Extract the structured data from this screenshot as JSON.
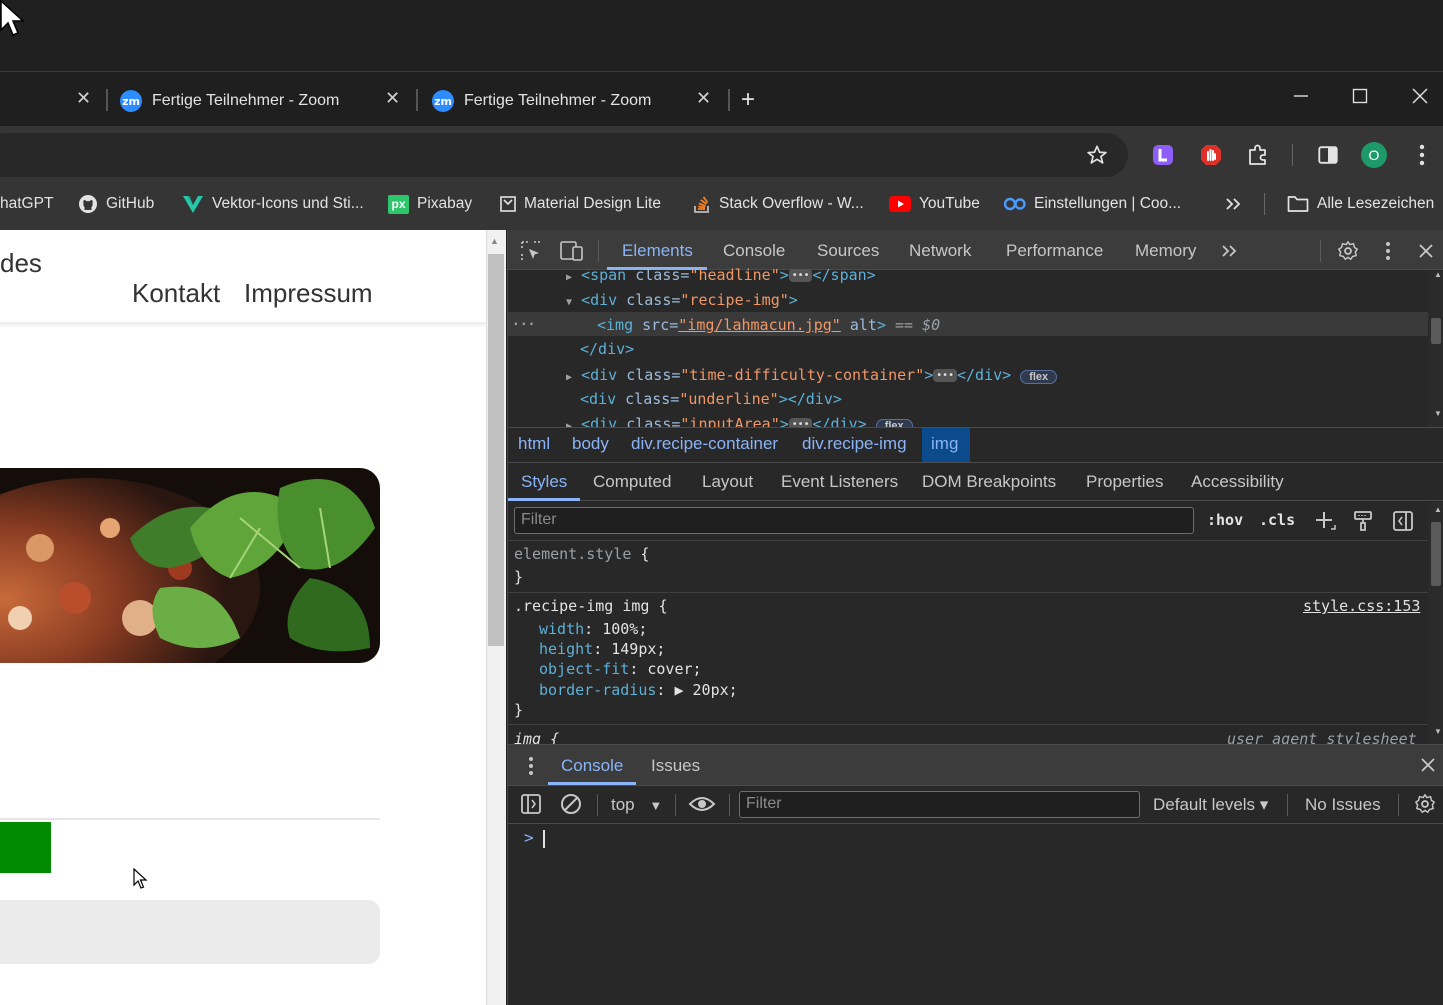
{
  "tabs": [
    {
      "label": "Fertige Teilnehmer - Zoom",
      "icon_text": "zm"
    },
    {
      "label": "Fertige Teilnehmer - Zoom",
      "icon_text": "zm"
    }
  ],
  "new_tab": "+",
  "profile_initial": "O",
  "bookmarks": {
    "items": [
      "hatGPT",
      "GitHub",
      "Vektor-Icons und Sti...",
      "Pixabay",
      "Material Design Lite",
      "Stack Overflow - W...",
      "YouTube",
      "Einstellungen | Coo..."
    ],
    "pixabay_icon_text": "px",
    "all_bookmarks": "Alle Lesezeichen"
  },
  "page": {
    "title_fragment": "des",
    "nav": [
      "Kontakt",
      "Impressum"
    ]
  },
  "devtools": {
    "tabs": [
      "Elements",
      "Console",
      "Sources",
      "Network",
      "Performance",
      "Memory"
    ],
    "active_tab": "Elements",
    "dom": {
      "line1": {
        "tag_open": "<span ",
        "attr": "class=",
        "val": "\"headline\"",
        "close": ">",
        "end": "</span>"
      },
      "line2": {
        "tag_open": "<div ",
        "attr": "class=",
        "val": "\"recipe-img\"",
        "close": ">"
      },
      "line3": {
        "tag_open": "<img ",
        "attr": "src=",
        "val": "\"img/lahmacun.jpg\"",
        "attr2": " alt",
        "close": ">",
        "suffix": " == $0"
      },
      "line4": "</div>",
      "line5": {
        "tag_open": "<div ",
        "attr": "class=",
        "val": "\"time-difficulty-container\"",
        "close": ">",
        "end": "</div>",
        "badge": "flex"
      },
      "line6": {
        "tag_open": "<div ",
        "attr": "class=",
        "val": "\"underline\"",
        "close": "></div>"
      },
      "line7": {
        "tag_open": "<div ",
        "attr": "class=",
        "val": "\"inputArea\"",
        "close": ">",
        "end": "</div>",
        "badge": "flex"
      },
      "ellipsis": "•••",
      "ellipsis_gutter": "..."
    },
    "breadcrumbs": [
      "html",
      "body",
      "div.recipe-container",
      "div.recipe-img",
      "img"
    ],
    "styles_tabs": [
      "Styles",
      "Computed",
      "Layout",
      "Event Listeners",
      "DOM Breakpoints",
      "Properties",
      "Accessibility"
    ],
    "styles_filter_placeholder": "Filter",
    "hov": ":hov",
    "cls": ".cls",
    "rules": {
      "element_style": "element.style",
      "open_brace": " {",
      "close_brace": "}",
      "selector": ".recipe-img img",
      "source": "style.css:153",
      "props": [
        {
          "name": "width",
          "value": "100%;"
        },
        {
          "name": "height",
          "value": "149px;"
        },
        {
          "name": "object-fit",
          "value": "cover;"
        },
        {
          "name": "border-radius",
          "value": "▶ 20px;"
        }
      ],
      "ua_selector": "img {",
      "ua_source": "user agent stylesheet"
    },
    "drawer": {
      "tabs": [
        "Console",
        "Issues"
      ],
      "context": "top",
      "filter_placeholder": "Filter",
      "levels": "Default levels ▾",
      "issues": "No Issues",
      "prompt": ">"
    }
  },
  "colors": {
    "accent": "#8ab4f8",
    "green_block": "#008a00",
    "zoom_blue": "#2d8cff"
  }
}
